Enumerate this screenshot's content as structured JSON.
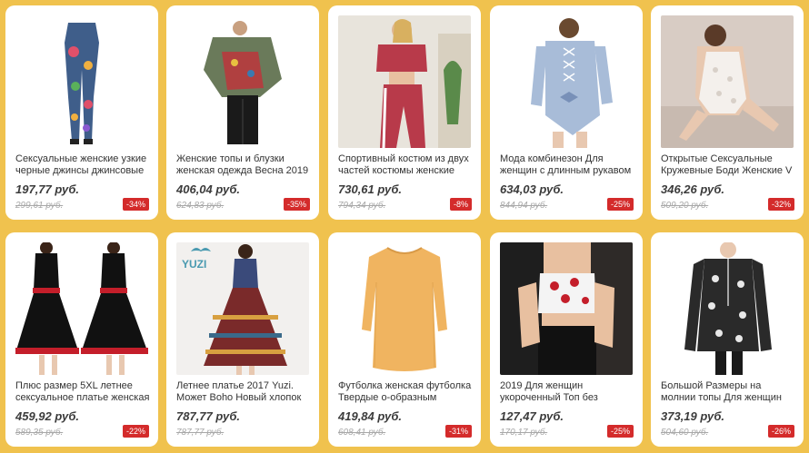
{
  "colors": {
    "page_bg": "#f0c24e",
    "badge_bg": "#d42b2b"
  },
  "products": [
    {
      "image": "floral-print-jeans",
      "title": "Сексуальные женские узкие черные джинсы джинсовые",
      "price": "197,77 руб.",
      "old_price": "299,61 руб.",
      "discount": "-34%"
    },
    {
      "image": "printed-blouse-pants",
      "title": "Женские топы и блузки женская одежда Весна 2019",
      "price": "406,04 руб.",
      "old_price": "624,83 руб.",
      "discount": "-35%"
    },
    {
      "image": "two-piece-tracksuit",
      "title": "Спортивный костюм из двух частей костюмы женские",
      "price": "730,61 руб.",
      "old_price": "794,34 руб.",
      "discount": "-8%"
    },
    {
      "image": "lace-up-bodysuit",
      "title": "Мода комбинезон Для женщин с длинным рукавом",
      "price": "634,03 руб.",
      "old_price": "844,94 руб.",
      "discount": "-25%"
    },
    {
      "image": "lace-bodysuit",
      "title": "Открытые Сексуальные Кружевные Боди Женские V",
      "price": "346,26 руб.",
      "old_price": "509,20 руб.",
      "discount": "-32%"
    },
    {
      "image": "black-red-dress",
      "title": "Плюс размер 5XL летнее сексуальное платье женская",
      "price": "459,92 руб.",
      "old_price": "589,35 руб.",
      "discount": "-22%"
    },
    {
      "image": "boho-maxi-dress",
      "title": "Летнее платье 2017 Yuzi. Может Boho Новый хлопок",
      "price": "787,77 руб.",
      "old_price": "787,77 руб.",
      "discount": "",
      "logo_text": "YUZI"
    },
    {
      "image": "yellow-tunic-tee",
      "title": "Футболка женская футболка Твердые о-образным вырезом",
      "price": "419,84 руб.",
      "old_price": "608,41 руб.",
      "discount": "-31%"
    },
    {
      "image": "rose-crop-top",
      "title": "2019 Для женщин укороченный Топ без",
      "price": "127,47 руб.",
      "old_price": "170,17 руб.",
      "discount": "-25%"
    },
    {
      "image": "paisley-zip-top",
      "title": "Большой Размеры на молнии топы Для женщин",
      "price": "373,19 руб.",
      "old_price": "504,60 руб.",
      "discount": "-26%"
    }
  ]
}
